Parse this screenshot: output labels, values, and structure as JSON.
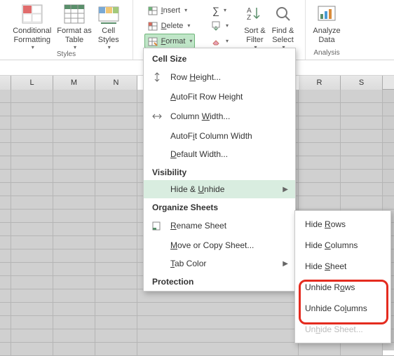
{
  "ribbon": {
    "styles": {
      "label": "Styles",
      "conditional": "Conditional\nFormatting",
      "formatAs": "Format as\nTable",
      "cellStyles": "Cell\nStyles"
    },
    "cells": {
      "insert": "Insert",
      "delete": "Delete",
      "format": "Format"
    },
    "editing": {
      "sort": "Sort &\nFilter",
      "find": "Find &\nSelect"
    },
    "analysis": {
      "label": "Analysis",
      "analyze": "Analyze\nData"
    }
  },
  "columns": [
    "L",
    "M",
    "N",
    "",
    "",
    "",
    "R",
    "S"
  ],
  "menu": {
    "cellSize": "Cell Size",
    "rowHeight": "Row Height...",
    "autoFitRow": "AutoFit Row Height",
    "colWidth": "Column Width...",
    "autoFitCol": "AutoFit Column Width",
    "defaultWidth": "Default Width...",
    "visibility": "Visibility",
    "hideUnhide": "Hide & Unhide",
    "organize": "Organize Sheets",
    "rename": "Rename Sheet",
    "moveCopy": "Move or Copy Sheet...",
    "tabColor": "Tab Color",
    "protection": "Protection"
  },
  "submenu": {
    "hideRows": "Hide Rows",
    "hideCols": "Hide Columns",
    "hideSheet": "Hide Sheet",
    "unhideRows": "Unhide Rows",
    "unhideCols": "Unhide Columns",
    "unhideSheet": "Unhide Sheet..."
  }
}
